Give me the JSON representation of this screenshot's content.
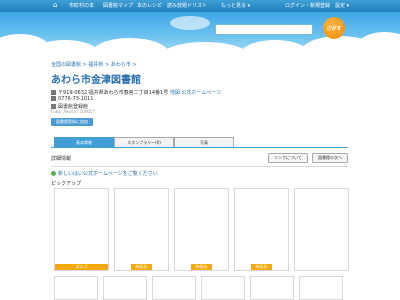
{
  "nav": {
    "items": [
      "市町村の本",
      "図書館マップ",
      "本のレシピ",
      "読み放題ドリスト",
      "もっと見る ▾",
      "ログイン・新規登録",
      "設定 ▾"
    ]
  },
  "search": {
    "placeholder": "",
    "button_label": "さがす"
  },
  "breadcrumb": "全国の図書館 > 福井県 > あわら市 >",
  "library": {
    "name": "あわら市金津図書館",
    "address": "〒919-0632 福井県あわら市春宮二丁目14番1号",
    "map_link": "地図",
    "homepage_link": "公式ホームページ",
    "phone": "0776-73-1011",
    "tag": "図書館登録館",
    "system_id": "Fukui_Awara / 100057"
  },
  "tag_button": "図書館登録に追加",
  "tabs": [
    "基本情報",
    "スタンプラリー(0)",
    "写真"
  ],
  "details": {
    "title": "詳細情報",
    "link_button": "リンクについて",
    "list_button": "図書館の次へ",
    "homepage_note": "新しいはい公式ホームページをご覧ください"
  },
  "pickup": {
    "title": "ピックアップ",
    "cards": [
      {
        "label": "ほるぷ"
      },
      {
        "label": "映画化"
      },
      {
        "label": "映画化"
      },
      {
        "label": "映画化"
      },
      {
        "label": ""
      }
    ]
  },
  "colors": {
    "accent": "#2a6fb0",
    "nav": "#1f7fbd",
    "orange": "#f08a00"
  }
}
